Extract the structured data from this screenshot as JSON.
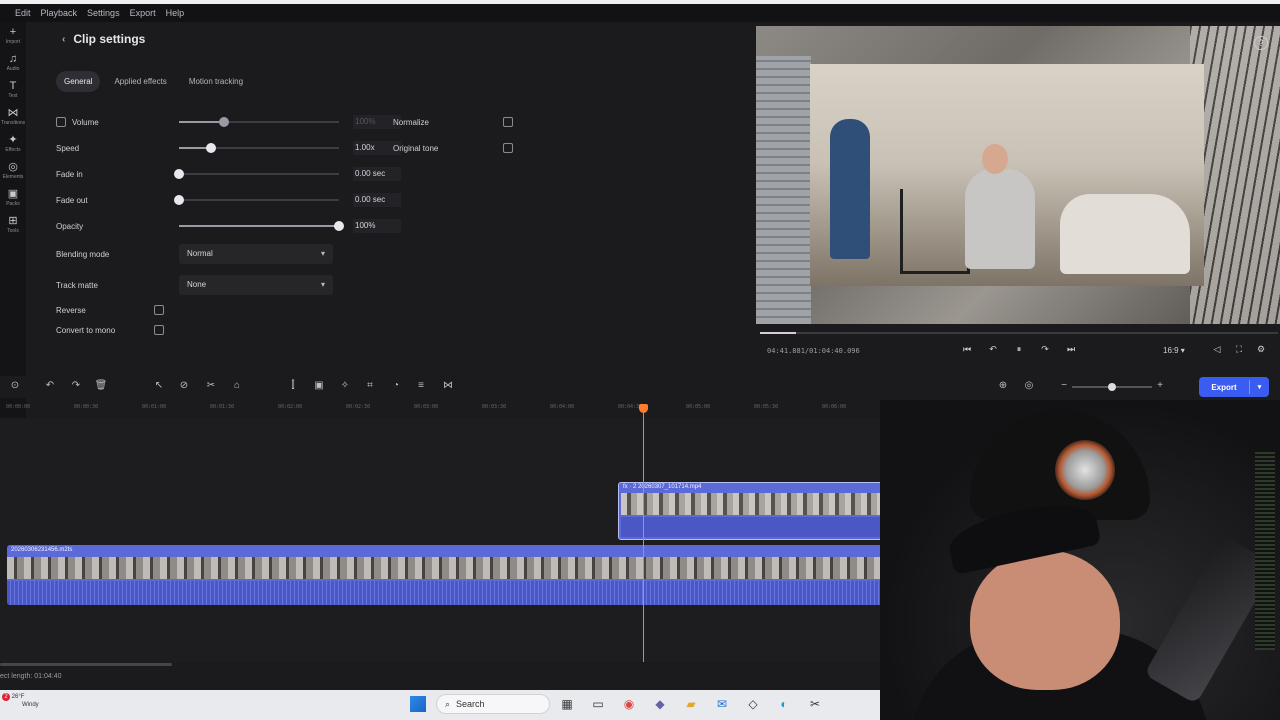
{
  "menu": [
    "Edit",
    "Playback",
    "Settings",
    "Export",
    "Help"
  ],
  "rail": [
    {
      "icon": "+",
      "label": "Import"
    },
    {
      "icon": "♫",
      "label": "Audio"
    },
    {
      "icon": "T",
      "label": "Text"
    },
    {
      "icon": "⋈",
      "label": "Transitions"
    },
    {
      "icon": "✦",
      "label": "Effects"
    },
    {
      "icon": "◎",
      "label": "Elements"
    },
    {
      "icon": "▣",
      "label": "Packs"
    },
    {
      "icon": "⊞",
      "label": "Tools"
    }
  ],
  "panel": {
    "title": "Clip settings",
    "tabs": [
      "General",
      "Applied effects",
      "Motion tracking"
    ],
    "volume_label": "Volume",
    "volume_value": "100%",
    "volume_level": 0.28,
    "speed_label": "Speed",
    "speed_value": "1.00x",
    "speed_level": 0.2,
    "fadein_label": "Fade in",
    "fadein_value": "0.00 sec",
    "fadeout_label": "Fade out",
    "fadeout_value": "0.00 sec",
    "opacity_label": "Opacity",
    "opacity_value": "100%",
    "opacity_level": 1.0,
    "blending_label": "Blending mode",
    "blending_value": "Normal",
    "matte_label": "Track matte",
    "matte_value": "None",
    "reverse_label": "Reverse",
    "mono_label": "Convert to mono",
    "normalize_label": "Normalize",
    "original_tone_label": "Original tone"
  },
  "player": {
    "timecode": "04:41.881/01:04:40.096",
    "aspect": "16:9",
    "progress": 0.07
  },
  "toolbar": {
    "export_label": "Export",
    "zoom_level": 0.45
  },
  "ruler": [
    "00:00:00",
    "00:00:30",
    "00:01:00",
    "00:01:30",
    "00:02:00",
    "00:02:30",
    "00:03:00",
    "00:03:30",
    "00:04:00",
    "00:04:30",
    "00:05:00",
    "00:05:30",
    "00:06:00",
    "00:06:30",
    "00:07:00",
    "00:07:30",
    "00:08:00",
    "00:08:30"
  ],
  "clips": {
    "top_name": "fx · 2  20260307_101714.mp4",
    "main_name": "20260306231456.m2ts"
  },
  "status": {
    "project_length": "ect length: 01:04:40"
  },
  "taskbar": {
    "weather_temp": "26°F",
    "weather_cond": "Windy",
    "notif": "2",
    "search_placeholder": "Search"
  },
  "colors": {
    "accent": "#3b5cf0",
    "clip": "#5b6ad8",
    "playhead": "#ff7b2e"
  }
}
